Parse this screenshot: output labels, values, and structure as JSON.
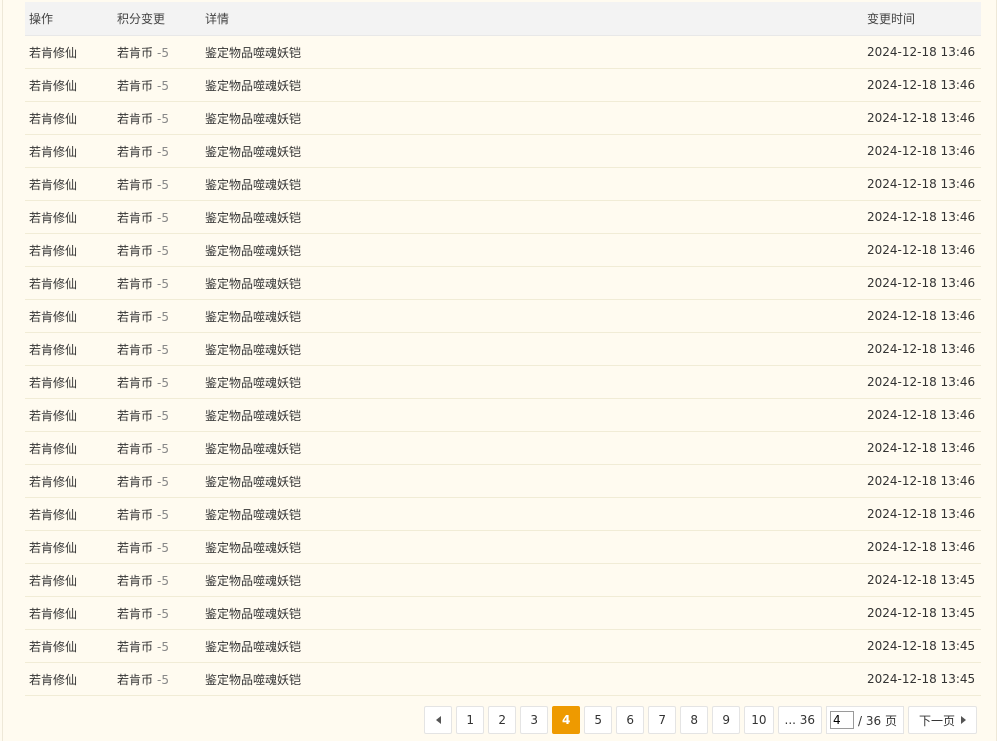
{
  "table": {
    "headers": {
      "op": "操作",
      "change": "积分变更",
      "detail": "详情",
      "time": "变更时间"
    },
    "rows": [
      {
        "op": "若肯修仙",
        "currency": "若肯币",
        "delta": "-5",
        "detail": "鉴定物品噬魂妖铠",
        "time": "2024-12-18 13:46"
      },
      {
        "op": "若肯修仙",
        "currency": "若肯币",
        "delta": "-5",
        "detail": "鉴定物品噬魂妖铠",
        "time": "2024-12-18 13:46"
      },
      {
        "op": "若肯修仙",
        "currency": "若肯币",
        "delta": "-5",
        "detail": "鉴定物品噬魂妖铠",
        "time": "2024-12-18 13:46"
      },
      {
        "op": "若肯修仙",
        "currency": "若肯币",
        "delta": "-5",
        "detail": "鉴定物品噬魂妖铠",
        "time": "2024-12-18 13:46"
      },
      {
        "op": "若肯修仙",
        "currency": "若肯币",
        "delta": "-5",
        "detail": "鉴定物品噬魂妖铠",
        "time": "2024-12-18 13:46"
      },
      {
        "op": "若肯修仙",
        "currency": "若肯币",
        "delta": "-5",
        "detail": "鉴定物品噬魂妖铠",
        "time": "2024-12-18 13:46"
      },
      {
        "op": "若肯修仙",
        "currency": "若肯币",
        "delta": "-5",
        "detail": "鉴定物品噬魂妖铠",
        "time": "2024-12-18 13:46"
      },
      {
        "op": "若肯修仙",
        "currency": "若肯币",
        "delta": "-5",
        "detail": "鉴定物品噬魂妖铠",
        "time": "2024-12-18 13:46"
      },
      {
        "op": "若肯修仙",
        "currency": "若肯币",
        "delta": "-5",
        "detail": "鉴定物品噬魂妖铠",
        "time": "2024-12-18 13:46"
      },
      {
        "op": "若肯修仙",
        "currency": "若肯币",
        "delta": "-5",
        "detail": "鉴定物品噬魂妖铠",
        "time": "2024-12-18 13:46"
      },
      {
        "op": "若肯修仙",
        "currency": "若肯币",
        "delta": "-5",
        "detail": "鉴定物品噬魂妖铠",
        "time": "2024-12-18 13:46"
      },
      {
        "op": "若肯修仙",
        "currency": "若肯币",
        "delta": "-5",
        "detail": "鉴定物品噬魂妖铠",
        "time": "2024-12-18 13:46"
      },
      {
        "op": "若肯修仙",
        "currency": "若肯币",
        "delta": "-5",
        "detail": "鉴定物品噬魂妖铠",
        "time": "2024-12-18 13:46"
      },
      {
        "op": "若肯修仙",
        "currency": "若肯币",
        "delta": "-5",
        "detail": "鉴定物品噬魂妖铠",
        "time": "2024-12-18 13:46"
      },
      {
        "op": "若肯修仙",
        "currency": "若肯币",
        "delta": "-5",
        "detail": "鉴定物品噬魂妖铠",
        "time": "2024-12-18 13:46"
      },
      {
        "op": "若肯修仙",
        "currency": "若肯币",
        "delta": "-5",
        "detail": "鉴定物品噬魂妖铠",
        "time": "2024-12-18 13:46"
      },
      {
        "op": "若肯修仙",
        "currency": "若肯币",
        "delta": "-5",
        "detail": "鉴定物品噬魂妖铠",
        "time": "2024-12-18 13:45"
      },
      {
        "op": "若肯修仙",
        "currency": "若肯币",
        "delta": "-5",
        "detail": "鉴定物品噬魂妖铠",
        "time": "2024-12-18 13:45"
      },
      {
        "op": "若肯修仙",
        "currency": "若肯币",
        "delta": "-5",
        "detail": "鉴定物品噬魂妖铠",
        "time": "2024-12-18 13:45"
      },
      {
        "op": "若肯修仙",
        "currency": "若肯币",
        "delta": "-5",
        "detail": "鉴定物品噬魂妖铠",
        "time": "2024-12-18 13:45"
      }
    ]
  },
  "pagination": {
    "prev_icon": "triangle-left-icon",
    "pages": [
      "1",
      "2",
      "3",
      "4",
      "5",
      "6",
      "7",
      "8",
      "9",
      "10"
    ],
    "current": "4",
    "last_page_label": "... 36",
    "jump_value": "4",
    "total_label": "/ 36 页",
    "next_label": "下一页",
    "next_icon": "triangle-right-icon"
  },
  "colors": {
    "background": "#fffbf0",
    "header_background": "#f3f3f3",
    "current_page": "#ee9a00"
  }
}
